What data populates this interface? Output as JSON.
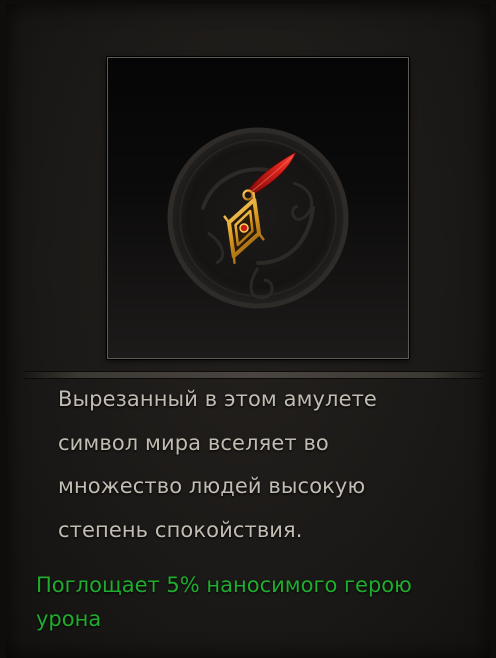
{
  "item": {
    "icon": "amulet-icon",
    "description": "Вырезанный в этом амулете символ мира вселяет во множество людей высокую степень спокойствия.",
    "bonus": "Поглощает 5% наносимого герою урона"
  },
  "colors": {
    "description_text": "#c2bcb3",
    "bonus_text": "#1fad2e",
    "gem_ribbon": "#c81c16",
    "gold": "#e0a526"
  }
}
